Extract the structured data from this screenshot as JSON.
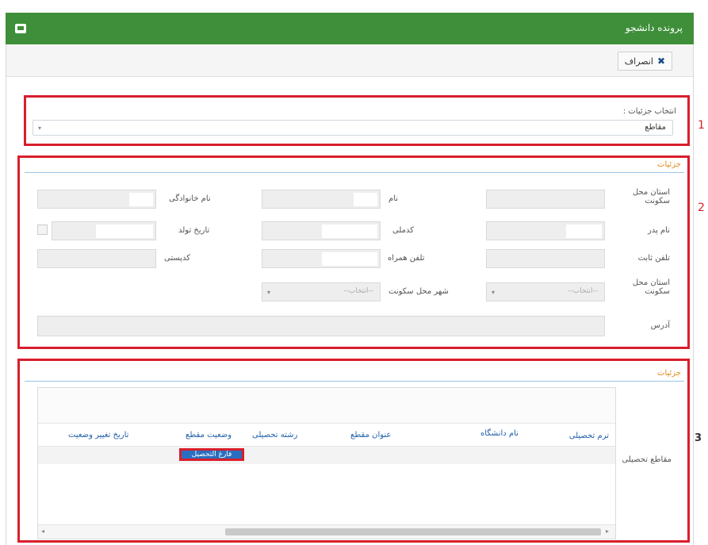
{
  "window": {
    "title": "پرونده دانشجو"
  },
  "toolbar": {
    "cancel_label": "انصراف"
  },
  "section1": {
    "label": "انتخاب جزئیات :",
    "selected": "مقاطع",
    "marker": "1"
  },
  "section2": {
    "header": "جزئیات",
    "marker": "2",
    "fields": {
      "province": "استان محل سکونت",
      "first_name": "نام",
      "last_name": "نام خانوادگی",
      "father_name": "نام پدر",
      "national_code": "کدملی",
      "birth_date": "تاریخ تولد",
      "phone": "تلفن ثابت",
      "mobile": "تلفن همراه",
      "postal_code": "کدپستی",
      "province2": "استان محل سکونت",
      "city": "شهر محل سکونت",
      "address": "آدرس"
    },
    "select_placeholder": "--انتخاب--"
  },
  "section3": {
    "header": "جزئیات",
    "marker": "3",
    "row_label": "مقاطع تحصیلی",
    "columns": [
      "ترم تحصیلی",
      "نام دانشگاه",
      "عنوان مقطع",
      "رشته تحصیلی",
      "وضعیت مقطع",
      "تاریخ تغییر وضعیت"
    ],
    "selected_cell": "فارغ التحصیل"
  },
  "colors": {
    "titlebar": "#3f8f3a",
    "highlight": "#d81e2c",
    "link": "#1f5fa8",
    "accent": "#e08a1e"
  }
}
